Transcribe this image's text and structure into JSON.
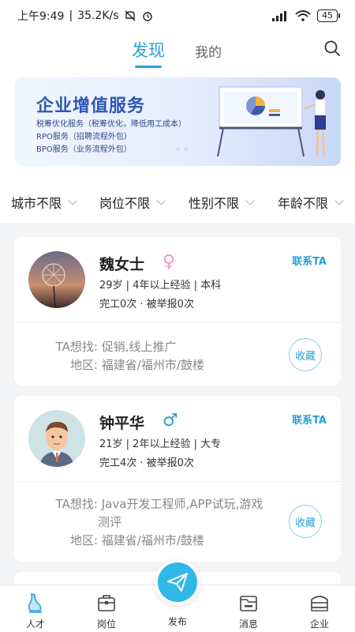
{
  "status_bar": {
    "time": "上午9:49",
    "network_speed": "35.2K/s",
    "battery": "45"
  },
  "header": {
    "tabs": [
      {
        "label": "发现",
        "active": true
      },
      {
        "label": "我的",
        "active": false
      }
    ],
    "search_icon": "search-icon"
  },
  "banner": {
    "title": "企业增值服务",
    "lines": [
      "税筹优化服务（税筹优化，降低用工成本）",
      "RPO服务（招聘流程外包）",
      "BPO服务（业务流程外包）"
    ]
  },
  "filters": [
    {
      "label": "城市不限"
    },
    {
      "label": "岗位不限"
    },
    {
      "label": "性别不限"
    },
    {
      "label": "年龄不限"
    }
  ],
  "candidates": [
    {
      "name": "魏女士",
      "gender": "female",
      "gender_symbol": "♀",
      "contact_label": "联系TA",
      "details": "29岁 | 4年以上经验 | 本科",
      "stats": "完工0次 · 被举报0次",
      "want_label": "TA想找:",
      "want_value": "促销,线上推广",
      "region_label": "地区:",
      "region_value": "福建省/福州市/鼓楼",
      "collect_label": "收藏"
    },
    {
      "name": "钟平华",
      "gender": "male",
      "gender_symbol": "♂",
      "contact_label": "联系TA",
      "details": "21岁 | 2年以上经验 | 大专",
      "stats": "完工4次 · 被举报0次",
      "want_label": "TA想找:",
      "want_value_line1": "Java开发工程师,APP试玩,游戏",
      "want_value_line2": "测评",
      "region_label": "地区:",
      "region_value": "福建省/福州市/鼓楼",
      "collect_label": "收藏"
    }
  ],
  "bottom_nav": [
    {
      "label": "人才",
      "icon": "talent-icon",
      "active": true
    },
    {
      "label": "岗位",
      "icon": "briefcase-icon",
      "active": false
    },
    {
      "label": "发布",
      "icon": "paper-plane-icon",
      "active": false
    },
    {
      "label": "消息",
      "icon": "message-icon",
      "active": false
    },
    {
      "label": "企业",
      "icon": "enterprise-icon",
      "active": false
    }
  ],
  "colors": {
    "accent": "#2a9fd6",
    "female": "#f29ac2",
    "male": "#2a9fd6",
    "fab": "#2fb8e8"
  }
}
